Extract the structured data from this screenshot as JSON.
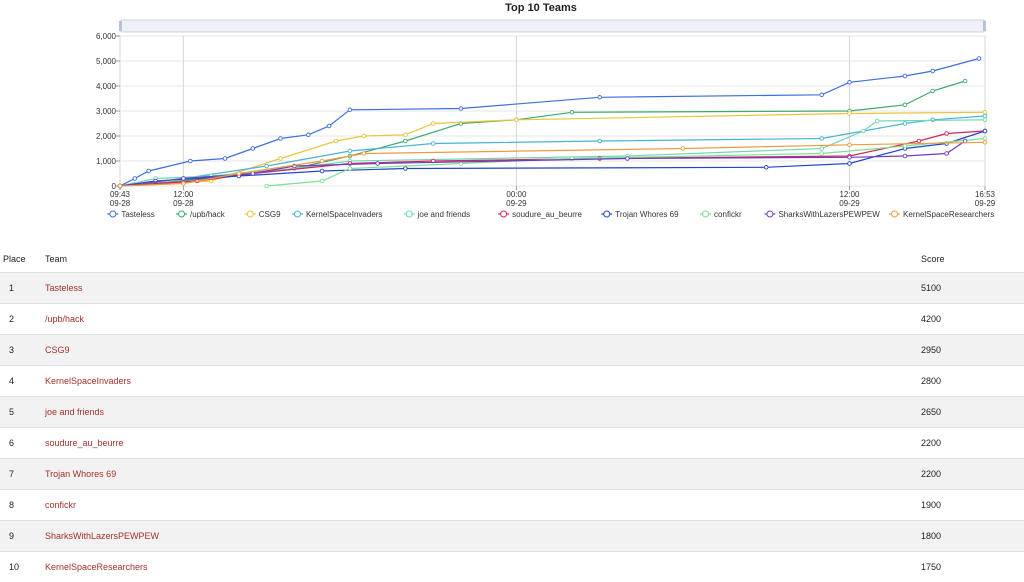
{
  "chart_data": {
    "type": "line",
    "title": "Top 10 Teams",
    "ylim": [
      0,
      6000
    ],
    "yticks": [
      "0",
      "1,000",
      "2,000",
      "3,000",
      "4,000",
      "5,000",
      "6,000"
    ],
    "xlim": [
      "2018-09-28 09:43",
      "2018-09-29 16:53"
    ],
    "xticks": [
      {
        "time": "2018-09-28 09:43",
        "top": "09:43",
        "bottom": "09-28"
      },
      {
        "time": "2018-09-28 12:00",
        "top": "12:00",
        "bottom": "09-28"
      },
      {
        "time": "2018-09-29 00:00",
        "top": "00:00",
        "bottom": "09-29"
      },
      {
        "time": "2018-09-29 12:00",
        "top": "12:00",
        "bottom": "09-29"
      },
      {
        "time": "2018-09-29 16:53",
        "top": "16:53",
        "bottom": "09-29"
      }
    ],
    "grid": true,
    "legend_position": "bottom",
    "series": [
      {
        "name": "Tasteless",
        "color": "#3f6fdc",
        "points": [
          [
            "2018-09-28 09:43",
            0
          ],
          [
            "2018-09-28 10:15",
            300
          ],
          [
            "2018-09-28 10:45",
            600
          ],
          [
            "2018-09-28 12:15",
            1000
          ],
          [
            "2018-09-28 13:30",
            1100
          ],
          [
            "2018-09-28 14:30",
            1500
          ],
          [
            "2018-09-28 15:30",
            1900
          ],
          [
            "2018-09-28 16:30",
            2050
          ],
          [
            "2018-09-28 17:15",
            2400
          ],
          [
            "2018-09-28 18:00",
            3050
          ],
          [
            "2018-09-28 22:00",
            3100
          ],
          [
            "2018-09-29 03:00",
            3550
          ],
          [
            "2018-09-29 11:00",
            3650
          ],
          [
            "2018-09-29 12:00",
            4150
          ],
          [
            "2018-09-29 14:00",
            4400
          ],
          [
            "2018-09-29 15:00",
            4600
          ],
          [
            "2018-09-29 16:40",
            5100
          ]
        ]
      },
      {
        "name": "/upb/hack",
        "color": "#3eaa6e",
        "points": [
          [
            "2018-09-28 09:43",
            0
          ],
          [
            "2018-09-28 13:00",
            300
          ],
          [
            "2018-09-28 16:00",
            700
          ],
          [
            "2018-09-28 18:00",
            1200
          ],
          [
            "2018-09-28 20:00",
            1800
          ],
          [
            "2018-09-28 22:00",
            2500
          ],
          [
            "2018-09-29 00:00",
            2650
          ],
          [
            "2018-09-29 02:00",
            2950
          ],
          [
            "2018-09-29 12:00",
            3000
          ],
          [
            "2018-09-29 14:00",
            3250
          ],
          [
            "2018-09-29 15:00",
            3800
          ],
          [
            "2018-09-29 16:10",
            4200
          ]
        ]
      },
      {
        "name": "CSG9",
        "color": "#e8c53b",
        "points": [
          [
            "2018-09-28 09:43",
            0
          ],
          [
            "2018-09-28 13:00",
            200
          ],
          [
            "2018-09-28 15:30",
            1100
          ],
          [
            "2018-09-28 17:30",
            1800
          ],
          [
            "2018-09-28 18:30",
            2000
          ],
          [
            "2018-09-28 20:00",
            2050
          ],
          [
            "2018-09-28 21:00",
            2500
          ],
          [
            "2018-09-29 00:00",
            2650
          ],
          [
            "2018-09-29 12:00",
            2900
          ],
          [
            "2018-09-29 16:53",
            2950
          ]
        ]
      },
      {
        "name": "KernelSpaceInvaders",
        "color": "#49b3d4",
        "points": [
          [
            "2018-09-28 09:43",
            0
          ],
          [
            "2018-09-28 12:00",
            300
          ],
          [
            "2018-09-28 15:00",
            800
          ],
          [
            "2018-09-28 18:00",
            1400
          ],
          [
            "2018-09-28 21:00",
            1700
          ],
          [
            "2018-09-29 03:00",
            1800
          ],
          [
            "2018-09-29 11:00",
            1900
          ],
          [
            "2018-09-29 14:00",
            2500
          ],
          [
            "2018-09-29 15:00",
            2650
          ],
          [
            "2018-09-29 16:53",
            2800
          ]
        ]
      },
      {
        "name": "joe and friends",
        "color": "#6fd8b3",
        "points": [
          [
            "2018-09-28 09:43",
            0
          ],
          [
            "2018-09-28 11:00",
            300
          ],
          [
            "2018-09-28 13:00",
            400
          ],
          [
            "2018-09-28 16:00",
            700
          ],
          [
            "2018-09-28 18:00",
            1000
          ],
          [
            "2018-09-29 04:00",
            1200
          ],
          [
            "2018-09-29 11:00",
            1500
          ],
          [
            "2018-09-29 12:30",
            2200
          ],
          [
            "2018-09-29 13:00",
            2600
          ],
          [
            "2018-09-29 16:53",
            2650
          ]
        ]
      },
      {
        "name": "soudure_au_beurre",
        "color": "#d3245e",
        "points": [
          [
            "2018-09-28 09:43",
            0
          ],
          [
            "2018-09-28 12:30",
            200
          ],
          [
            "2018-09-28 14:30",
            500
          ],
          [
            "2018-09-28 18:00",
            900
          ],
          [
            "2018-09-28 21:00",
            1000
          ],
          [
            "2018-09-29 03:00",
            1100
          ],
          [
            "2018-09-29 12:00",
            1200
          ],
          [
            "2018-09-29 14:30",
            1800
          ],
          [
            "2018-09-29 15:30",
            2100
          ],
          [
            "2018-09-29 16:53",
            2200
          ]
        ]
      },
      {
        "name": "Trojan Whores 69",
        "color": "#2146c7",
        "points": [
          [
            "2018-09-28 09:43",
            0
          ],
          [
            "2018-09-28 11:00",
            200
          ],
          [
            "2018-09-28 14:00",
            400
          ],
          [
            "2018-09-28 17:00",
            600
          ],
          [
            "2018-09-28 20:00",
            700
          ],
          [
            "2018-09-29 09:00",
            750
          ],
          [
            "2018-09-29 12:00",
            900
          ],
          [
            "2018-09-29 14:00",
            1500
          ],
          [
            "2018-09-29 15:30",
            1700
          ],
          [
            "2018-09-29 16:53",
            2200
          ]
        ]
      },
      {
        "name": "confickr",
        "color": "#7ee08f",
        "points": [
          [
            "2018-09-28 15:00",
            0
          ],
          [
            "2018-09-28 17:00",
            200
          ],
          [
            "2018-09-28 18:00",
            700
          ],
          [
            "2018-09-28 22:00",
            900
          ],
          [
            "2018-09-29 02:00",
            1100
          ],
          [
            "2018-09-29 11:00",
            1300
          ],
          [
            "2018-09-29 14:00",
            1600
          ],
          [
            "2018-09-29 16:53",
            1900
          ]
        ]
      },
      {
        "name": "SharksWithLazersPEWPEW",
        "color": "#6c3fc2",
        "points": [
          [
            "2018-09-28 09:43",
            0
          ],
          [
            "2018-09-28 12:00",
            300
          ],
          [
            "2018-09-28 14:30",
            500
          ],
          [
            "2018-09-28 16:00",
            800
          ],
          [
            "2018-09-28 19:00",
            900
          ],
          [
            "2018-09-29 04:00",
            1100
          ],
          [
            "2018-09-29 12:00",
            1150
          ],
          [
            "2018-09-29 14:00",
            1200
          ],
          [
            "2018-09-29 15:30",
            1300
          ],
          [
            "2018-09-29 16:10",
            1800
          ]
        ]
      },
      {
        "name": "KernelSpaceResearchers",
        "color": "#f09a3e",
        "points": [
          [
            "2018-09-28 09:43",
            0
          ],
          [
            "2018-09-28 12:00",
            100
          ],
          [
            "2018-09-28 14:00",
            500
          ],
          [
            "2018-09-28 17:00",
            1000
          ],
          [
            "2018-09-28 18:30",
            1300
          ],
          [
            "2018-09-29 06:00",
            1500
          ],
          [
            "2018-09-29 12:00",
            1650
          ],
          [
            "2018-09-29 16:53",
            1750
          ]
        ]
      }
    ]
  },
  "scoreboard": {
    "headers": {
      "place": "Place",
      "team": "Team",
      "score": "Score"
    },
    "rows": [
      {
        "place": "1",
        "team": "Tasteless",
        "score": "5100"
      },
      {
        "place": "2",
        "team": "/upb/hack",
        "score": "4200"
      },
      {
        "place": "3",
        "team": "CSG9",
        "score": "2950"
      },
      {
        "place": "4",
        "team": "KernelSpaceInvaders",
        "score": "2800"
      },
      {
        "place": "5",
        "team": "joe and friends",
        "score": "2650"
      },
      {
        "place": "6",
        "team": "soudure_au_beurre",
        "score": "2200"
      },
      {
        "place": "7",
        "team": "Trojan Whores 69",
        "score": "2200"
      },
      {
        "place": "8",
        "team": "confickr",
        "score": "1900"
      },
      {
        "place": "9",
        "team": "SharksWithLazersPEWPEW",
        "score": "1800"
      },
      {
        "place": "10",
        "team": "KernelSpaceResearchers",
        "score": "1750"
      }
    ]
  }
}
